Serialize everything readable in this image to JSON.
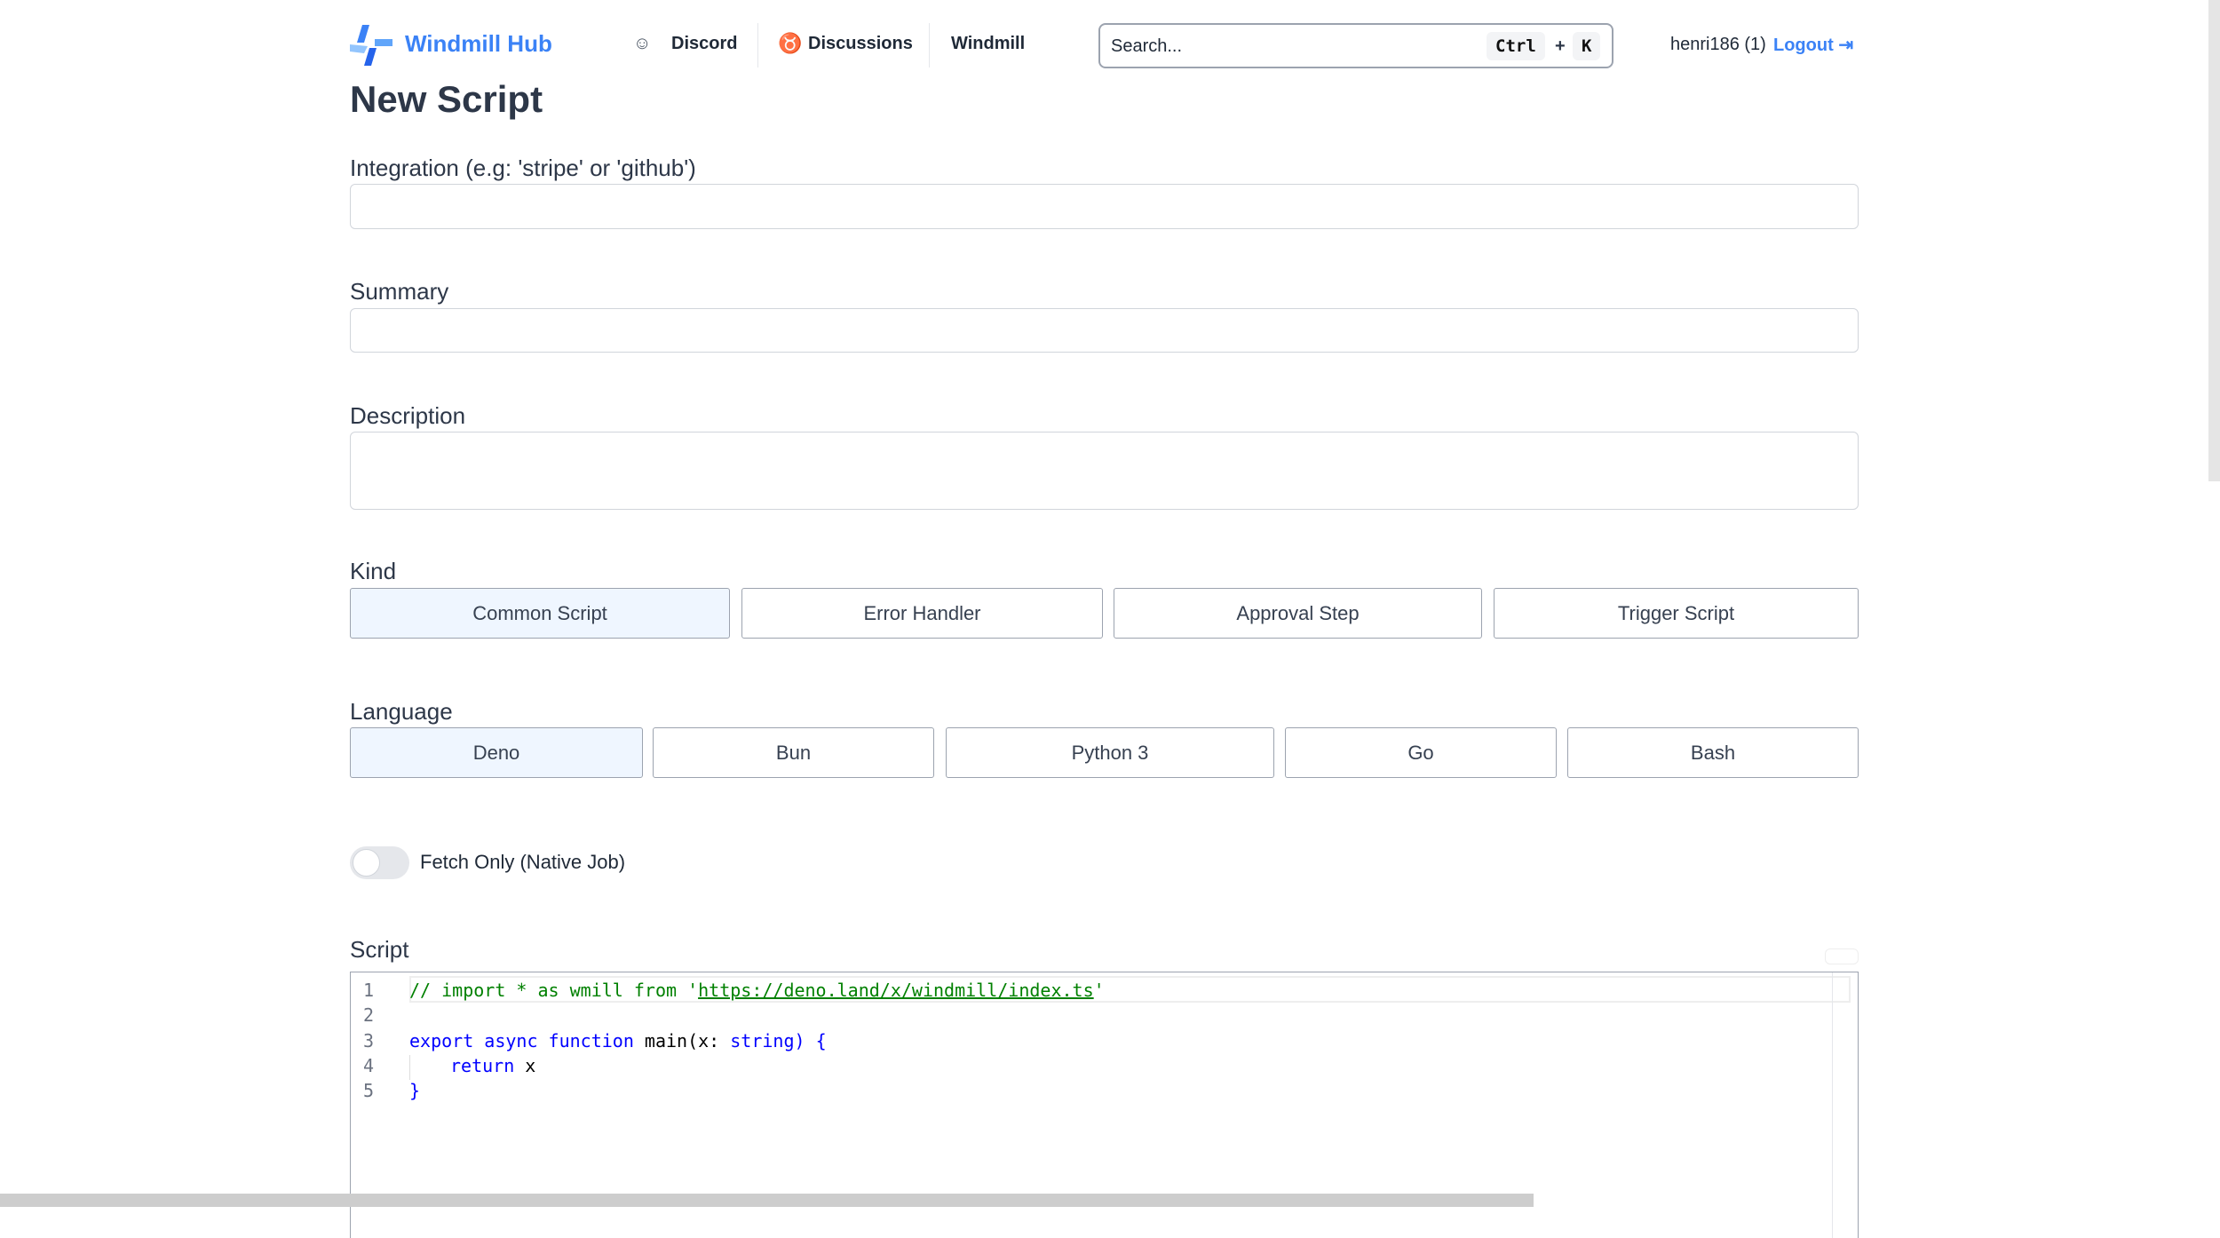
{
  "header": {
    "brand": "Windmill Hub",
    "nav": [
      {
        "label": "Discord",
        "icon": "discord-icon"
      },
      {
        "label": "Discussions",
        "icon": "github-icon"
      },
      {
        "label": "Windmill"
      }
    ],
    "search": {
      "placeholder": "Search...",
      "shortcut": [
        "Ctrl",
        "+",
        "K"
      ]
    },
    "user": "henri186 (1)",
    "logout": "Logout"
  },
  "page": {
    "title": "New Script"
  },
  "form": {
    "integration": {
      "label": "Integration (e.g: 'stripe' or 'github')",
      "value": ""
    },
    "summary": {
      "label": "Summary",
      "value": ""
    },
    "description": {
      "label": "Description",
      "value": ""
    },
    "kind": {
      "label": "Kind",
      "options": [
        "Common Script",
        "Error Handler",
        "Approval Step",
        "Trigger Script"
      ],
      "selected": "Common Script"
    },
    "language": {
      "label": "Language",
      "options": [
        "Deno",
        "Bun",
        "Python 3",
        "Go",
        "Bash"
      ],
      "selected": "Deno"
    },
    "fetch_only": {
      "label": "Fetch Only (Native Job)",
      "checked": false
    },
    "script": {
      "label": "Script",
      "lines": [
        "1",
        "2",
        "3",
        "4",
        "5"
      ],
      "code": {
        "l1a": "// import * as wmill from '",
        "l1url": "https://deno.land/x/windmill/index.ts",
        "l1b": "'",
        "l3kw": "export async function",
        "l3fn": " main(x: ",
        "l3ty": "string",
        "l3end": ") {",
        "l4kw": "return",
        "l4v": " x",
        "l5": "}"
      }
    }
  },
  "colors": {
    "accent": "#3b82f6",
    "selected_bg": "#eff6ff"
  }
}
